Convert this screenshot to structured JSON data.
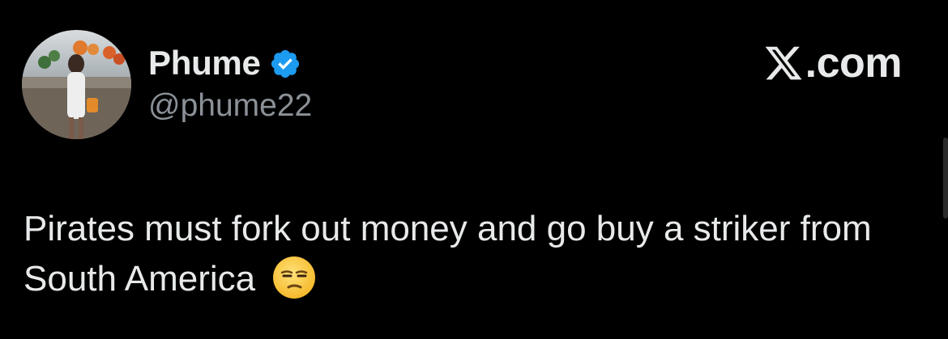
{
  "tweet": {
    "author": {
      "display_name": "Phume",
      "handle": "@phume22",
      "verified": true,
      "verified_color": "#1d9bf0",
      "avatar_icon": "profile-photo"
    },
    "brand": {
      "icon": "x-logo-icon",
      "suffix": ".com"
    },
    "text": "Pirates must fork out money and go buy a striker from South America",
    "emoji": "unamused-face"
  },
  "colors": {
    "background": "#000000",
    "primary_text": "#e7e9ea",
    "secondary_text": "#8b9197"
  }
}
